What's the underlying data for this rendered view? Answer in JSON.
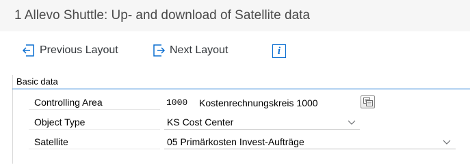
{
  "window": {
    "title": "1 Allevo Shuttle: Up- and download of Satellite data"
  },
  "toolbar": {
    "previous_layout": "Previous Layout",
    "next_layout": "Next Layout",
    "info_glyph": "i",
    "icons": {
      "previous": "previous-layout-icon",
      "next": "next-layout-icon",
      "info": "info-icon"
    }
  },
  "basic_data": {
    "title": "Basic data",
    "fields": [
      {
        "label": "Controlling Area",
        "code": "1000",
        "description": "Kostenrechnungskreis 1000"
      },
      {
        "label": "Object Type",
        "value": "KS Cost Center"
      },
      {
        "label": "Satellite",
        "value": "05 Primärkosten Invest-Aufträge"
      }
    ]
  },
  "colors": {
    "accent": "#0a6ed1",
    "title_bar_bg": "#f6f6f6"
  }
}
